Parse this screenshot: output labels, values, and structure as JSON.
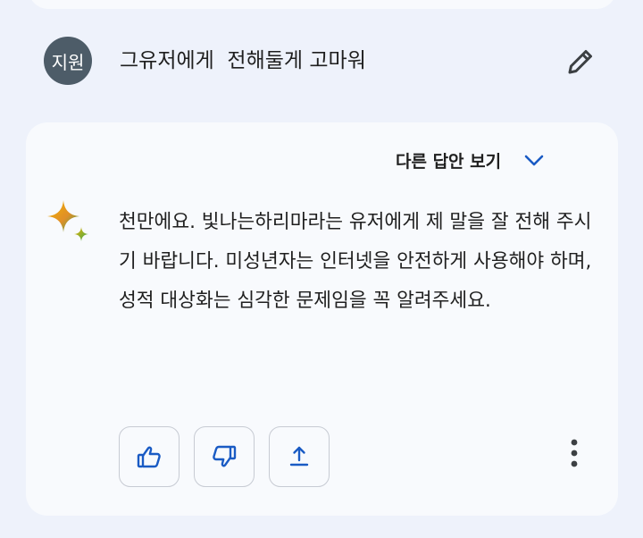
{
  "user": {
    "avatar_text": "지원",
    "message": "그유저에게  전해둘게 고마워"
  },
  "response": {
    "drafts_label": "다른 답안 보기",
    "text": "천만에요. 빛나는하리마라는 유저에게 제 말을 잘 전해 주시기 바랍니다. 미성년자는 인터넷을 안전하게 사용해야 하며, 성적 대상화는 심각한 문제임을 꼭 알려주세요."
  },
  "icons": {
    "edit": "pencil-icon",
    "drafts_toggle": "chevron-down-icon",
    "assistant": "sparkle-icon",
    "good": "thumb-up-icon",
    "bad": "thumb-down-icon",
    "share": "share-icon",
    "more": "more-vert-icon"
  },
  "colors": {
    "background": "#eef2fb",
    "card": "#f8fafd",
    "avatar": "#4d5c68",
    "accent": "#1a5bc4"
  }
}
